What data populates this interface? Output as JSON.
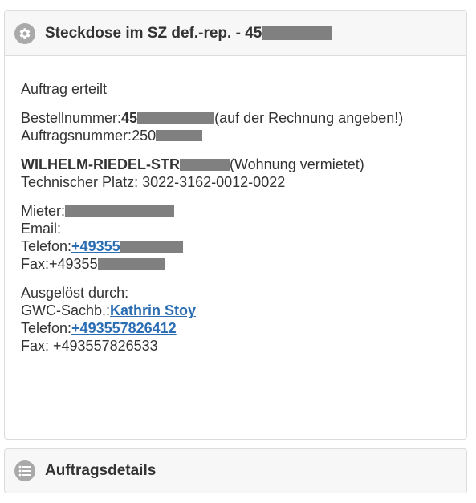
{
  "order_panel": {
    "title": "Steckdose im SZ def.-rep. - 45",
    "status": "Auftrag erteilt",
    "bestell_label": "Bestellnummer: ",
    "bestell_value": "45",
    "bestell_note": "(auf der Rechnung angeben!)",
    "auftrag_label": "Auftragsnummer: ",
    "auftrag_value": "250",
    "address_street": "WILHELM-RIEDEL-STR",
    "address_note": " (Wohnung vermietet)",
    "tech_place": "Technischer Platz: 3022-3162-0012-0022",
    "tenant_label": "Mieter: ",
    "email_label": "Email:",
    "phone_label": "Telefon: ",
    "tenant_phone": "+49355",
    "fax_label": "Fax: ",
    "tenant_fax": "+49355",
    "triggered_by": "Ausgelöst durch:",
    "gwc_label": "GWC-Sachb.:",
    "gwc_name": "Kathrin Stoy",
    "gwc_phone_label": "Telefon: ",
    "gwc_phone": "+493557826412",
    "gwc_fax": "Fax: +493557826533"
  },
  "details_panel": {
    "title": "Auftragsdetails"
  },
  "icons": {
    "order": "gear-icon",
    "details": "list-icon"
  }
}
